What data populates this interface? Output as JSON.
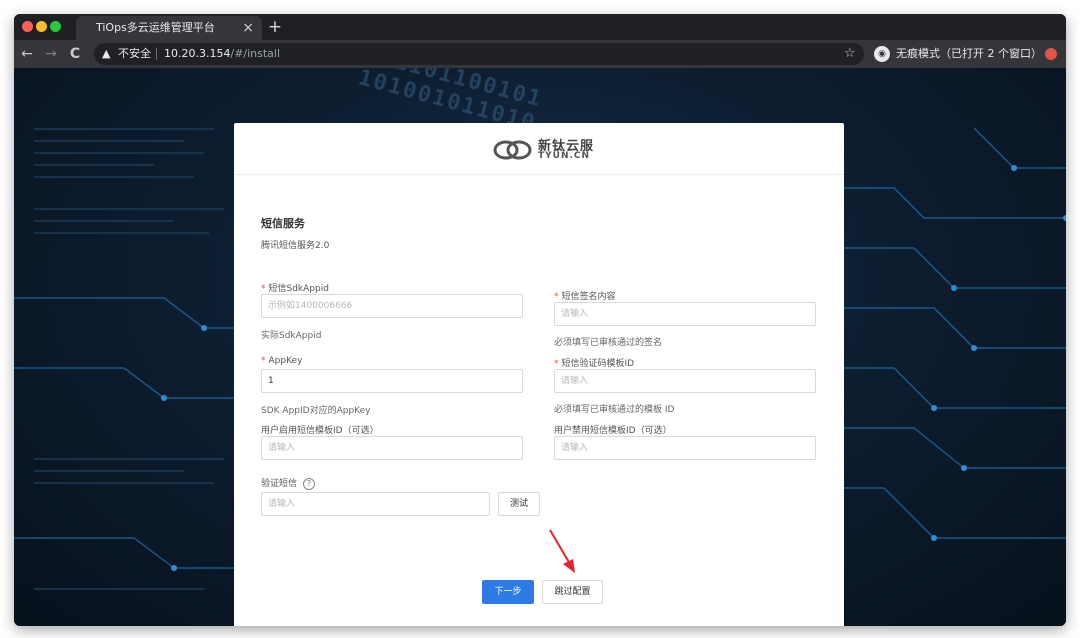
{
  "browser": {
    "tab_title": "TiOps多云运维管理平台",
    "tab_close": "×",
    "new_tab": "+",
    "insecure_label": "不安全",
    "url_host": "10.20.3.154",
    "url_path": "/#/install",
    "incognito_label": "无痕模式（已打开 2 个窗口）",
    "nav_back": "←",
    "nav_forward": "→",
    "nav_reload": "C",
    "star": "☆",
    "traffic_colors": [
      "#ff5f57",
      "#febc2e",
      "#28c840"
    ]
  },
  "background": {
    "binary_text": "1001101100101\n 101001011010"
  },
  "logo": {
    "cn": "新钛云服",
    "en": "TYUN.CN"
  },
  "form": {
    "section_title": "短信服务",
    "section_subtitle": "腾讯短信服务2.0",
    "required_mark": "*",
    "sdk_appid": {
      "label": "短信SdkAppid",
      "placeholder": "示例如1400006666",
      "hint": "实际SdkAppid"
    },
    "sign_content": {
      "label": "短信签名内容",
      "placeholder": "请输入",
      "hint": "必须填写已审核通过的签名"
    },
    "app_key": {
      "label": "AppKey",
      "value": "1",
      "hint": "SDK AppID对应的AppKey"
    },
    "verify_template": {
      "label": "短信验证码模板ID",
      "placeholder": "请输入",
      "hint": "必须填写已审核通过的模板 ID"
    },
    "enable_template": {
      "label": "用户启用短信模板ID（可选）",
      "placeholder": "请输入"
    },
    "disable_template": {
      "label": "用户禁用短信模板ID（可选）",
      "placeholder": "请输入"
    },
    "verify_sms": {
      "label": "验证短信",
      "help": "?",
      "placeholder": "请输入",
      "test_button": "测试"
    },
    "next_button": "下一步",
    "skip_button": "跳过配置"
  },
  "colors": {
    "primary": "#2d7ce6",
    "required": "#e54b4b",
    "arrow": "#e8222a"
  }
}
